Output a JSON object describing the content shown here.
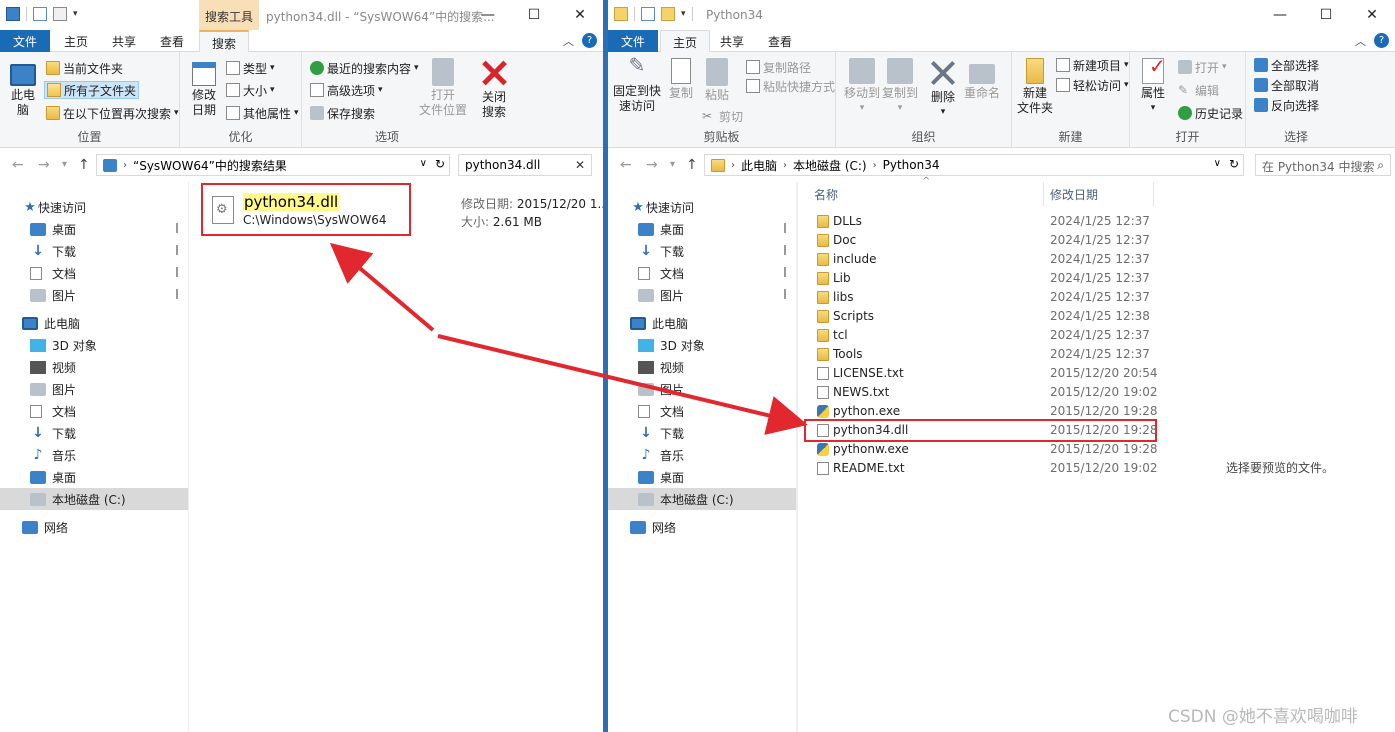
{
  "left": {
    "window_title": "python34.dll - “SysWOW64”中的搜索...",
    "context_tab": "搜索工具",
    "tabs": [
      "文件",
      "主页",
      "共享",
      "查看",
      "搜索"
    ],
    "ribbon": {
      "this_pc": "此电\n脑",
      "current_folder": "当前文件夹",
      "all_subfolders": "所有子文件夹",
      "search_again_in": "在以下位置再次搜索",
      "group_location": "位置",
      "modified_date": "修改\n日期",
      "kind": "类型",
      "size": "大小",
      "other_properties": "其他属性",
      "group_refine": "优化",
      "recent_searches": "最近的搜索内容",
      "advanced_options": "高级选项",
      "save_search": "保存搜索",
      "open_file_location": "打开\n文件位置",
      "close_search": "关闭\n搜索",
      "group_options": "选项"
    },
    "address": "“SysWOW64”中的搜索结果",
    "search_query": "python34.dll",
    "nav": {
      "quick_access": "快速访问",
      "items": [
        "桌面",
        "下载",
        "文档",
        "图片"
      ],
      "this_pc": "此电脑",
      "pc_items": [
        "3D 对象",
        "视频",
        "图片",
        "文档",
        "下载",
        "音乐",
        "桌面",
        "本地磁盘 (C:)"
      ],
      "network": "网络"
    },
    "result": {
      "name": "python34.dll",
      "path": "C:\\Windows\\SysWOW64",
      "modified_label": "修改日期:",
      "modified_value": "2015/12/20 1...",
      "size_label": "大小:",
      "size_value": "2.61 MB"
    }
  },
  "right": {
    "window_title": "Python34",
    "tabs": [
      "文件",
      "主页",
      "共享",
      "查看"
    ],
    "ribbon": {
      "pin_quick_access": "固定到快\n速访问",
      "copy": "复制",
      "paste": "粘贴",
      "copy_path": "复制路径",
      "paste_shortcut": "粘贴快捷方式",
      "cut": "剪切",
      "group_clipboard": "剪贴板",
      "move_to": "移动到",
      "copy_to": "复制到",
      "delete": "删除",
      "rename": "重命名",
      "group_organize": "组织",
      "new_folder": "新建\n文件夹",
      "new_item": "新建项目",
      "easy_access": "轻松访问",
      "group_new": "新建",
      "properties": "属性",
      "open": "打开",
      "edit": "编辑",
      "history": "历史记录",
      "group_open": "打开",
      "select_all": "全部选择",
      "select_none": "全部取消",
      "invert_selection": "反向选择",
      "group_select": "选择"
    },
    "breadcrumb": [
      "此电脑",
      "本地磁盘 (C:)",
      "Python34"
    ],
    "search_placeholder": "在 Python34 中搜索",
    "columns": {
      "name": "名称",
      "modified": "修改日期"
    },
    "nav": {
      "quick_access": "快速访问",
      "items": [
        "桌面",
        "下载",
        "文档",
        "图片"
      ],
      "this_pc": "此电脑",
      "pc_items": [
        "3D 对象",
        "视频",
        "图片",
        "文档",
        "下载",
        "音乐",
        "桌面",
        "本地磁盘 (C:)"
      ],
      "network": "网络"
    },
    "files": [
      {
        "name": "DLLs",
        "date": "2024/1/25 12:37",
        "kind": "folder"
      },
      {
        "name": "Doc",
        "date": "2024/1/25 12:37",
        "kind": "folder"
      },
      {
        "name": "include",
        "date": "2024/1/25 12:37",
        "kind": "folder"
      },
      {
        "name": "Lib",
        "date": "2024/1/25 12:37",
        "kind": "folder"
      },
      {
        "name": "libs",
        "date": "2024/1/25 12:37",
        "kind": "folder"
      },
      {
        "name": "Scripts",
        "date": "2024/1/25 12:38",
        "kind": "folder"
      },
      {
        "name": "tcl",
        "date": "2024/1/25 12:37",
        "kind": "folder"
      },
      {
        "name": "Tools",
        "date": "2024/1/25 12:37",
        "kind": "folder"
      },
      {
        "name": "LICENSE.txt",
        "date": "2015/12/20 20:54",
        "kind": "txt"
      },
      {
        "name": "NEWS.txt",
        "date": "2015/12/20 19:02",
        "kind": "txt"
      },
      {
        "name": "python.exe",
        "date": "2015/12/20 19:28",
        "kind": "py"
      },
      {
        "name": "python34.dll",
        "date": "2015/12/20 19:28",
        "kind": "dll"
      },
      {
        "name": "pythonw.exe",
        "date": "2015/12/20 19:28",
        "kind": "py"
      },
      {
        "name": "README.txt",
        "date": "2015/12/20 19:02",
        "kind": "txt"
      }
    ],
    "preview_message": "选择要预览的文件。"
  },
  "watermark": "CSDN @她不喜欢喝咖啡",
  "colors": {
    "accent": "#1a6bb5",
    "highlight_box": "#e0282e",
    "arrow": "#e0282e",
    "search_highlight": "#fff88a"
  }
}
